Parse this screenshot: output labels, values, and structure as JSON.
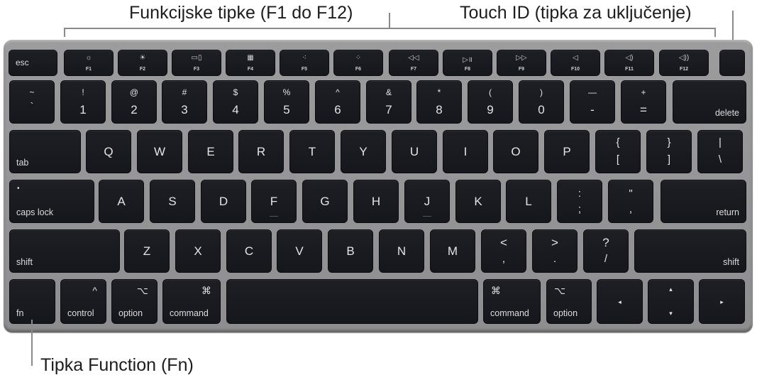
{
  "annotations": {
    "function_keys": "Funkcijske tipke (F1 do F12)",
    "touch_id": "Touch ID (tipka za uključenje)",
    "fn_key": "Tipka Function (Fn)"
  },
  "rows": {
    "function": {
      "esc": "esc",
      "keys": [
        {
          "label": "F1",
          "icon": "☼",
          "icon_name": "brightness-down-icon"
        },
        {
          "label": "F2",
          "icon": "☀",
          "icon_name": "brightness-up-icon"
        },
        {
          "label": "F3",
          "icon": "▭▯",
          "icon_name": "mission-control-icon"
        },
        {
          "label": "F4",
          "icon": "▦",
          "icon_name": "launchpad-icon"
        },
        {
          "label": "F5",
          "icon": "⁖",
          "icon_name": "keyboard-backlight-down-icon"
        },
        {
          "label": "F6",
          "icon": "⁘",
          "icon_name": "keyboard-backlight-up-icon"
        },
        {
          "label": "F7",
          "icon": "◁◁",
          "icon_name": "rewind-icon"
        },
        {
          "label": "F8",
          "icon": "▷॥",
          "icon_name": "play-pause-icon"
        },
        {
          "label": "F9",
          "icon": "▷▷",
          "icon_name": "fast-forward-icon"
        },
        {
          "label": "F10",
          "icon": "◁",
          "icon_name": "mute-icon"
        },
        {
          "label": "F11",
          "icon": "◁)",
          "icon_name": "volume-down-icon"
        },
        {
          "label": "F12",
          "icon": "◁))",
          "icon_name": "volume-up-icon"
        }
      ]
    },
    "number": {
      "keys": [
        {
          "top": "~",
          "bottom": "`"
        },
        {
          "top": "!",
          "bottom": "1"
        },
        {
          "top": "@",
          "bottom": "2"
        },
        {
          "top": "#",
          "bottom": "3"
        },
        {
          "top": "$",
          "bottom": "4"
        },
        {
          "top": "%",
          "bottom": "5"
        },
        {
          "top": "^",
          "bottom": "6"
        },
        {
          "top": "&",
          "bottom": "7"
        },
        {
          "top": "*",
          "bottom": "8"
        },
        {
          "top": "(",
          "bottom": "9"
        },
        {
          "top": ")",
          "bottom": "0"
        },
        {
          "top": "—",
          "bottom": "-"
        },
        {
          "top": "+",
          "bottom": "="
        }
      ],
      "delete": "delete"
    },
    "qwerty": {
      "tab": "tab",
      "letters": [
        "Q",
        "W",
        "E",
        "R",
        "T",
        "Y",
        "U",
        "I",
        "O",
        "P"
      ],
      "symbols": [
        {
          "top": "{",
          "bottom": "["
        },
        {
          "top": "}",
          "bottom": "]"
        },
        {
          "top": "|",
          "bottom": "\\"
        }
      ]
    },
    "home": {
      "caps_lock": "caps lock",
      "caps_indicator": "•",
      "letters": [
        "A",
        "S",
        "D",
        "F",
        "G",
        "H",
        "J",
        "K",
        "L"
      ],
      "symbols": [
        {
          "top": ":",
          "bottom": ";"
        },
        {
          "top": "\"",
          "bottom": ","
        }
      ],
      "return": "return"
    },
    "shift": {
      "left": "shift",
      "letters": [
        "Z",
        "X",
        "C",
        "V",
        "B",
        "N",
        "M"
      ],
      "symbols": [
        {
          "top": "<",
          "bottom": ","
        },
        {
          "top": ">",
          "bottom": "."
        },
        {
          "top": "?",
          "bottom": "/"
        }
      ],
      "right": "shift"
    },
    "bottom": {
      "fn": "fn",
      "control": {
        "label": "control",
        "symbol": "^"
      },
      "option_left": {
        "label": "option",
        "symbol": "⌥"
      },
      "command_left": {
        "label": "command",
        "symbol": "⌘"
      },
      "command_right": {
        "label": "command",
        "symbol": "⌘"
      },
      "option_right": {
        "label": "option",
        "symbol": "⌥"
      },
      "arrows": {
        "left": "◂",
        "up": "▴",
        "down": "▾",
        "right": "▸"
      }
    }
  }
}
